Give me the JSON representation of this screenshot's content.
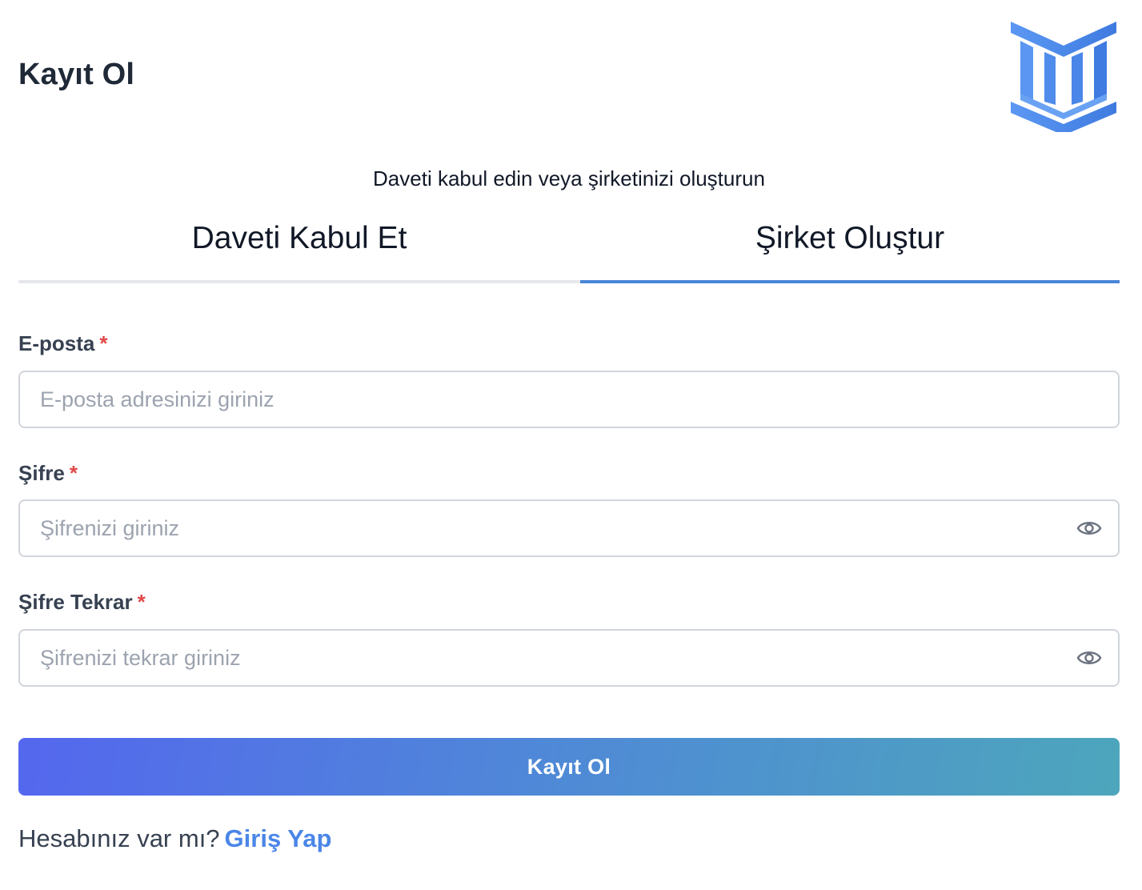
{
  "header": {
    "title": "Kayıt Ol",
    "logo_icon": "columns-building-icon",
    "logo_color": "#4a86e8"
  },
  "subtitle": "Daveti kabul edin veya şirketinizi oluşturun",
  "tabs": [
    {
      "label": "Daveti Kabul Et",
      "active": false
    },
    {
      "label": "Şirket Oluştur",
      "active": true
    }
  ],
  "form": {
    "email": {
      "label": "E-posta",
      "required_mark": "*",
      "value": "",
      "placeholder": "E-posta adresinizi giriniz"
    },
    "password": {
      "label": "Şifre",
      "required_mark": "*",
      "value": "",
      "placeholder": "Şifrenizi giriniz",
      "toggle_icon": "eye-icon"
    },
    "password_confirm": {
      "label": "Şifre Tekrar",
      "required_mark": "*",
      "value": "",
      "placeholder": "Şifrenizi tekrar giriniz",
      "toggle_icon": "eye-icon"
    },
    "submit_label": "Kayıt Ol"
  },
  "footer": {
    "prompt": "Hesabınız var mı?",
    "login_link": "Giriş Yap"
  },
  "colors": {
    "accent": "#4a86d8",
    "required": "#e04848",
    "button_gradient_start": "#5467ee",
    "button_gradient_end": "#4da6bc"
  }
}
